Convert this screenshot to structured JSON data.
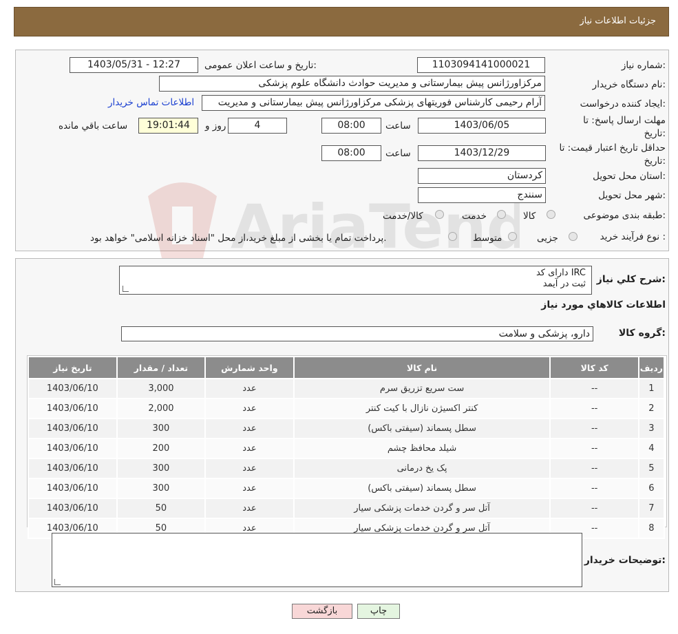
{
  "header": {
    "title": "جزئیات اطلاعات نیاز"
  },
  "details": {
    "need_number_label": "شماره نیاز:",
    "need_number": "1103094141000021",
    "announce_label": "تاریخ و ساعت اعلان عمومی:",
    "announce_value": "1403/05/31 - 12:27",
    "buyer_org_label": "نام دستگاه خریدار:",
    "buyer_org": "مرکزاورژانس پیش بیمارستانی و مدیریت حوادث دانشگاه علوم پزشکی",
    "creator_label": "ایجاد کننده درخواست:",
    "creator": "آرام رحیمی کارشناس فوریتهای پزشکی مرکزاورژانس پیش بیمارستانی و مدیریت",
    "contact_link": "اطلاعات تماس خریدار",
    "deadline_label": "مهلت ارسال پاسخ: تا تاریخ:",
    "deadline_date": "1403/06/05",
    "time_label": "ساعت",
    "deadline_time": "08:00",
    "days_value": "4",
    "days_label": "روز و",
    "remaining_time": "19:01:44",
    "remaining_label": "ساعت باقي مانده",
    "validity_label": "حداقل تاریخ اعتبار قیمت: تا تاریخ:",
    "validity_date": "1403/12/29",
    "validity_time": "08:00",
    "province_label": "استان محل تحویل:",
    "province": "کردستان",
    "city_label": "شهر محل تحویل:",
    "city": "سنندج",
    "category_label": "طبقه بندی موضوعی:",
    "category_options": [
      "کالا",
      "خدمت",
      "کالا/خدمت"
    ],
    "process_label": "نوع فرآیند خرید :",
    "process_options": [
      "جزیی",
      "متوسط"
    ],
    "process_note": "پرداخت تمام یا بخشی از مبلغ خرید،از محل \"اسناد خزانه اسلامی\" خواهد بود."
  },
  "description": {
    "label": "شرح کلي نياز:",
    "line1": "دارای کد IRC",
    "line2": "ثبت در آیمد"
  },
  "goods": {
    "section_title": "اطلاعات کالاهاي مورد نياز",
    "group_label": "گروه کالا:",
    "group_value": "دارو، پزشکی و سلامت",
    "columns": [
      "ردیف",
      "کد کالا",
      "نام کالا",
      "واحد شمارش",
      "تعداد / مقدار",
      "تاریخ نیاز"
    ],
    "rows": [
      [
        "1",
        "--",
        "ست سریع تزریق سرم",
        "عدد",
        "3,000",
        "1403/06/10"
      ],
      [
        "2",
        "--",
        "کنتر اکسیژن نازال با کیت کنتر",
        "عدد",
        "2,000",
        "1403/06/10"
      ],
      [
        "3",
        "--",
        "سطل پسماند (سیفتی باکس)",
        "عدد",
        "300",
        "1403/06/10"
      ],
      [
        "4",
        "--",
        "شیلد محافظ چشم",
        "عدد",
        "200",
        "1403/06/10"
      ],
      [
        "5",
        "--",
        "پک یخ درمانی",
        "عدد",
        "300",
        "1403/06/10"
      ],
      [
        "6",
        "--",
        "سطل پسماند (سیفتی باکس)",
        "عدد",
        "300",
        "1403/06/10"
      ],
      [
        "7",
        "--",
        "آتل سر و گردن خدمات پزشکی سیار",
        "عدد",
        "50",
        "1403/06/10"
      ],
      [
        "8",
        "--",
        "آتل سر و گردن خدمات پزشکی سیار",
        "عدد",
        "50",
        "1403/06/10"
      ]
    ]
  },
  "buyer_notes": {
    "label": "توضیحات خریدار:",
    "value": ""
  },
  "buttons": {
    "print": "چاپ",
    "back": "بازگشت"
  },
  "colors": {
    "header": "#8b6a3f",
    "table_header": "#8c8c8c",
    "link": "#1a3fd0",
    "back_button": "#f8d7d7",
    "print_button": "#e4f5e0"
  },
  "watermark": "AriaTender.neT"
}
